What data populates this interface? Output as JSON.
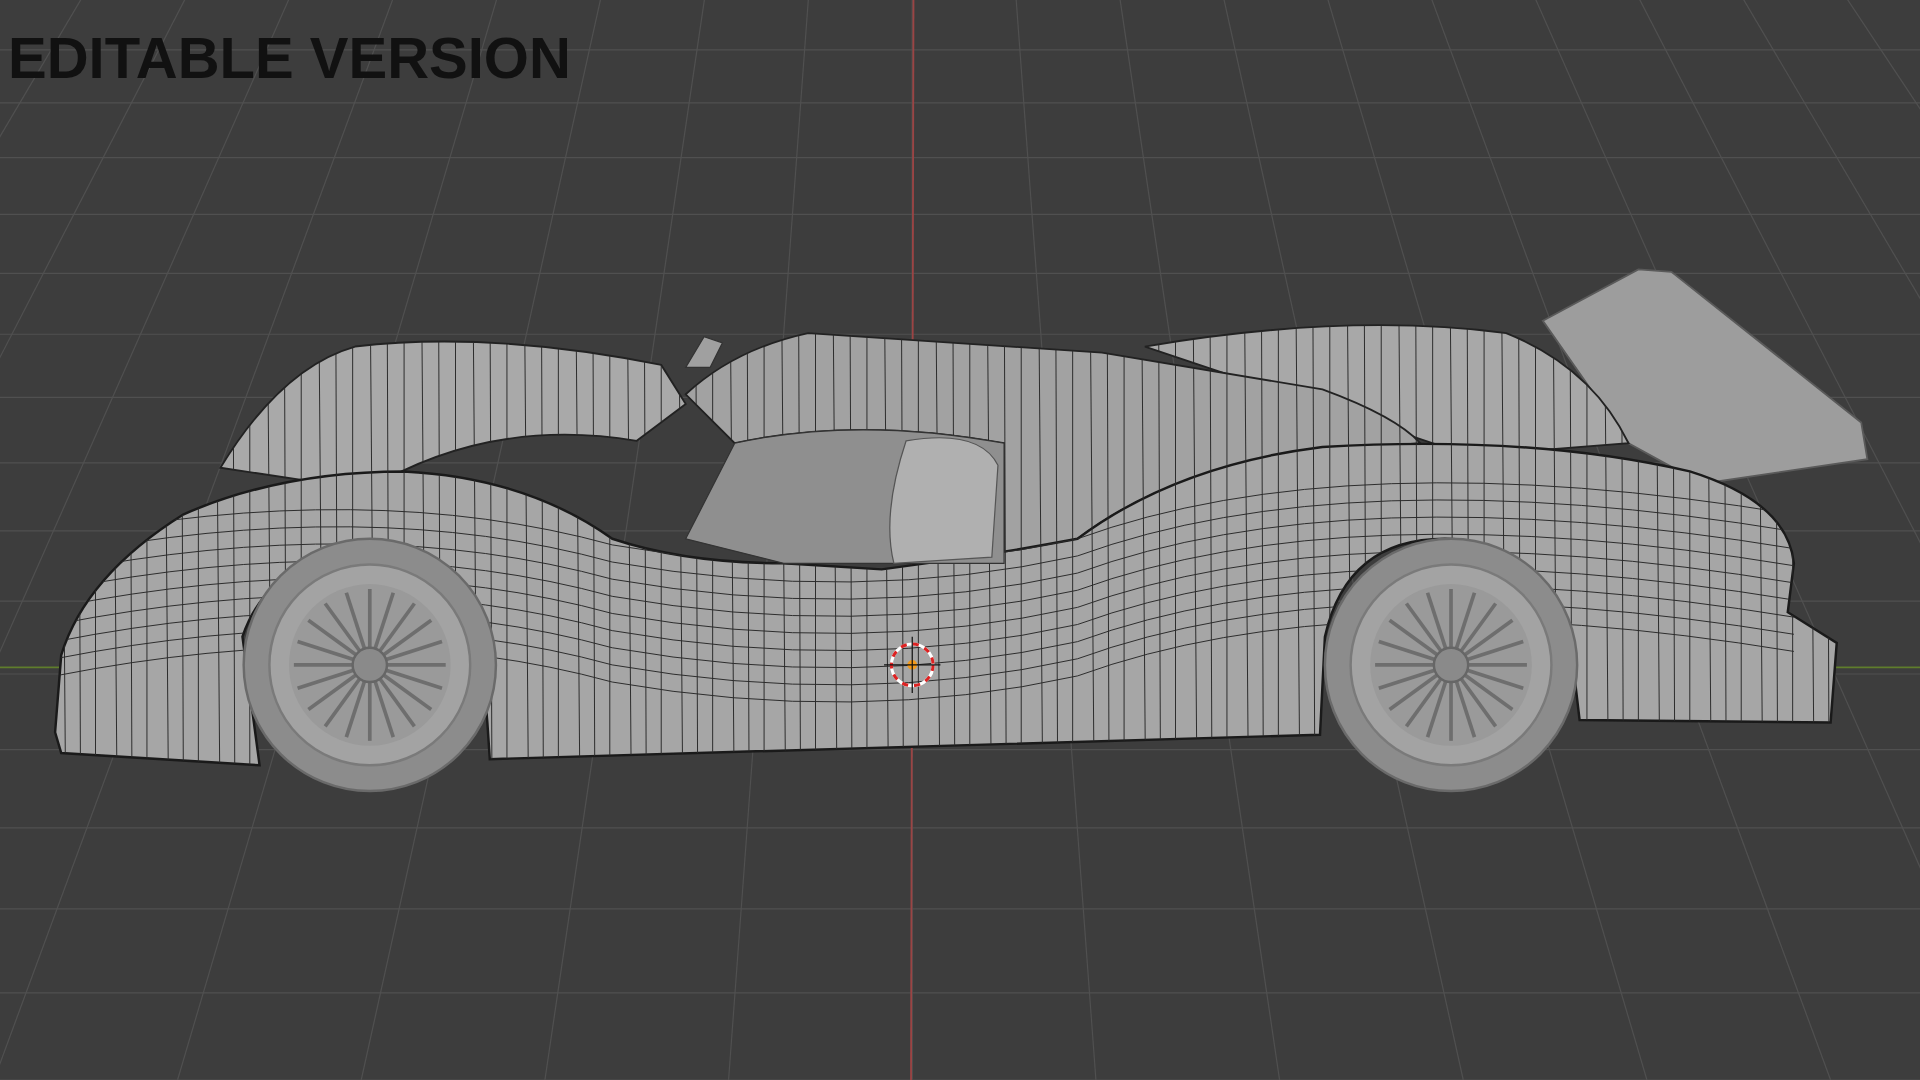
{
  "overlay_text": "EDITABLE VERSION"
}
